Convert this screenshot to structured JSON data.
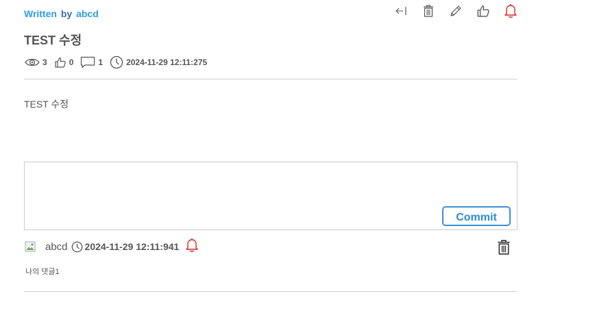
{
  "post": {
    "written_label": "Written",
    "by_label": "by",
    "author": "abcd",
    "title": "TEST 수정",
    "views": "3",
    "likes": "0",
    "comments": "1",
    "timestamp": "2024-11-29 12:11:275",
    "body": "TEST 수정"
  },
  "actions": {
    "icons": [
      "back-icon",
      "trash-icon",
      "pencil-icon",
      "thumbs-up-icon",
      "bell-icon"
    ],
    "bell_color": "#e02020"
  },
  "comment_form": {
    "value": "",
    "submit_label": "Commit"
  },
  "comment": {
    "author": "abcd",
    "timestamp": "2024-11-29 12:11:941",
    "text": "나의 댓글1"
  },
  "colors": {
    "accent": "#2b9ce6",
    "button_border": "#3a90d4",
    "text": "#555555",
    "alert": "#e02020"
  }
}
